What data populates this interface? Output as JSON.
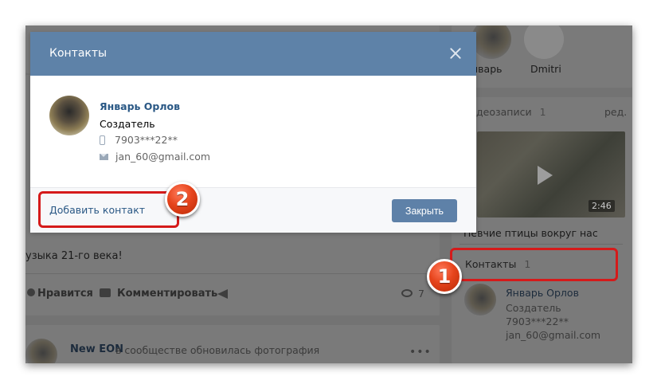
{
  "modal": {
    "title": "Контакты",
    "contact": {
      "name": "Январь Орлов",
      "role": "Создатель",
      "phone": "7903***22**",
      "email": "jan_60@gmail.com"
    },
    "add_contact_label": "Добавить контакт",
    "close_button_label": "Закрыть"
  },
  "background": {
    "friends": [
      "нварь",
      "Dmitri"
    ],
    "videos_label": "деозаписи",
    "videos_count": "1",
    "edit_label": "ред.",
    "video_duration": "2:46",
    "video_title": "Певчие птицы вокруг нас",
    "contacts_label": "Контакты",
    "contacts_count": "1",
    "contact": {
      "name": "Январь Орлов",
      "role": "Создатель",
      "phone": "7903***22**",
      "email": "jan_60@gmail.com"
    },
    "post_text": "узыка 21-го века!",
    "like_label": "Нравится",
    "comment_label": "Комментировать",
    "views_count": "7",
    "feed_author": "New EON",
    "feed_action": "в сообществе обновилась фотография"
  },
  "annotations": {
    "badge_1": "1",
    "badge_2": "2",
    "highlight_color": "#d51a1a"
  },
  "colors": {
    "header": "#5e82a8",
    "link": "#2a5885",
    "button": "#5e81a8"
  }
}
